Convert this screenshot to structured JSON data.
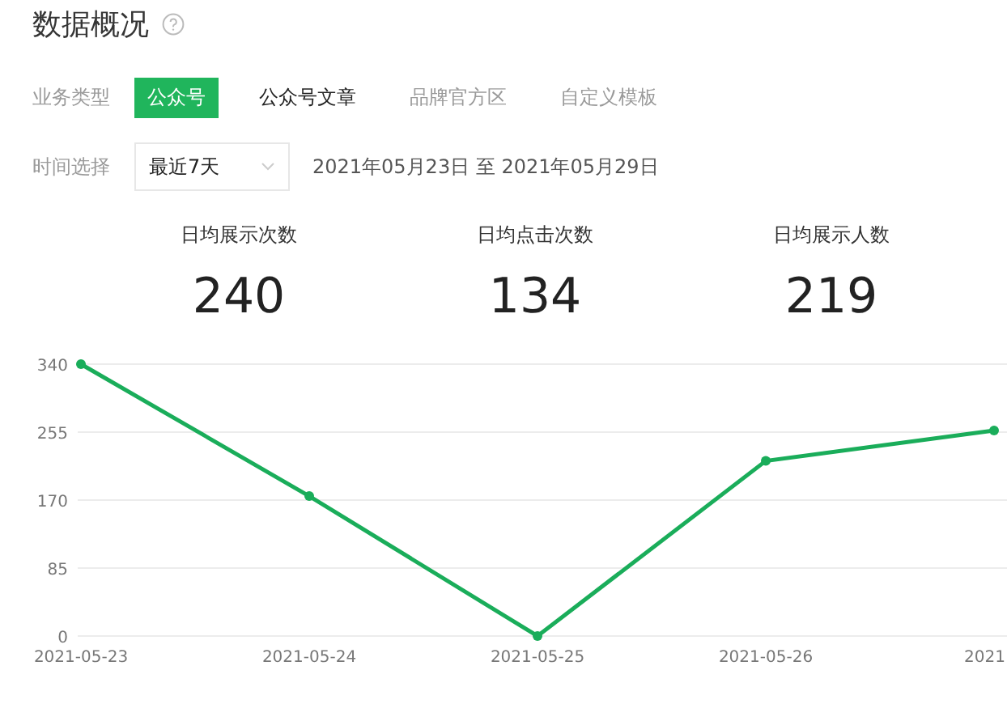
{
  "title": "数据概况",
  "business_type": {
    "label": "业务类型",
    "tabs": [
      {
        "label": "公众号",
        "selected": true
      },
      {
        "label": "公众号文章",
        "selected": false
      },
      {
        "label": "品牌官方区",
        "selected": false
      },
      {
        "label": "自定义模板",
        "selected": false
      }
    ]
  },
  "time_select": {
    "label": "时间选择",
    "value": "最近7天",
    "range": "2021年05月23日 至 2021年05月29日"
  },
  "stats": [
    {
      "label": "日均展示次数",
      "value": "240"
    },
    {
      "label": "日均点击次数",
      "value": "134"
    },
    {
      "label": "日均展示人数",
      "value": "219"
    }
  ],
  "chart_data": {
    "type": "line",
    "categories": [
      "2021-05-23",
      "2021-05-24",
      "2021-05-25",
      "2021-05-26",
      "2021"
    ],
    "ylim": [
      0,
      340
    ],
    "yticks": [
      0,
      85,
      170,
      255,
      340
    ],
    "grid": true,
    "series": [
      {
        "color": "#1aad5a",
        "marker": true,
        "values": [
          340,
          175,
          0,
          219,
          257
        ]
      }
    ]
  }
}
